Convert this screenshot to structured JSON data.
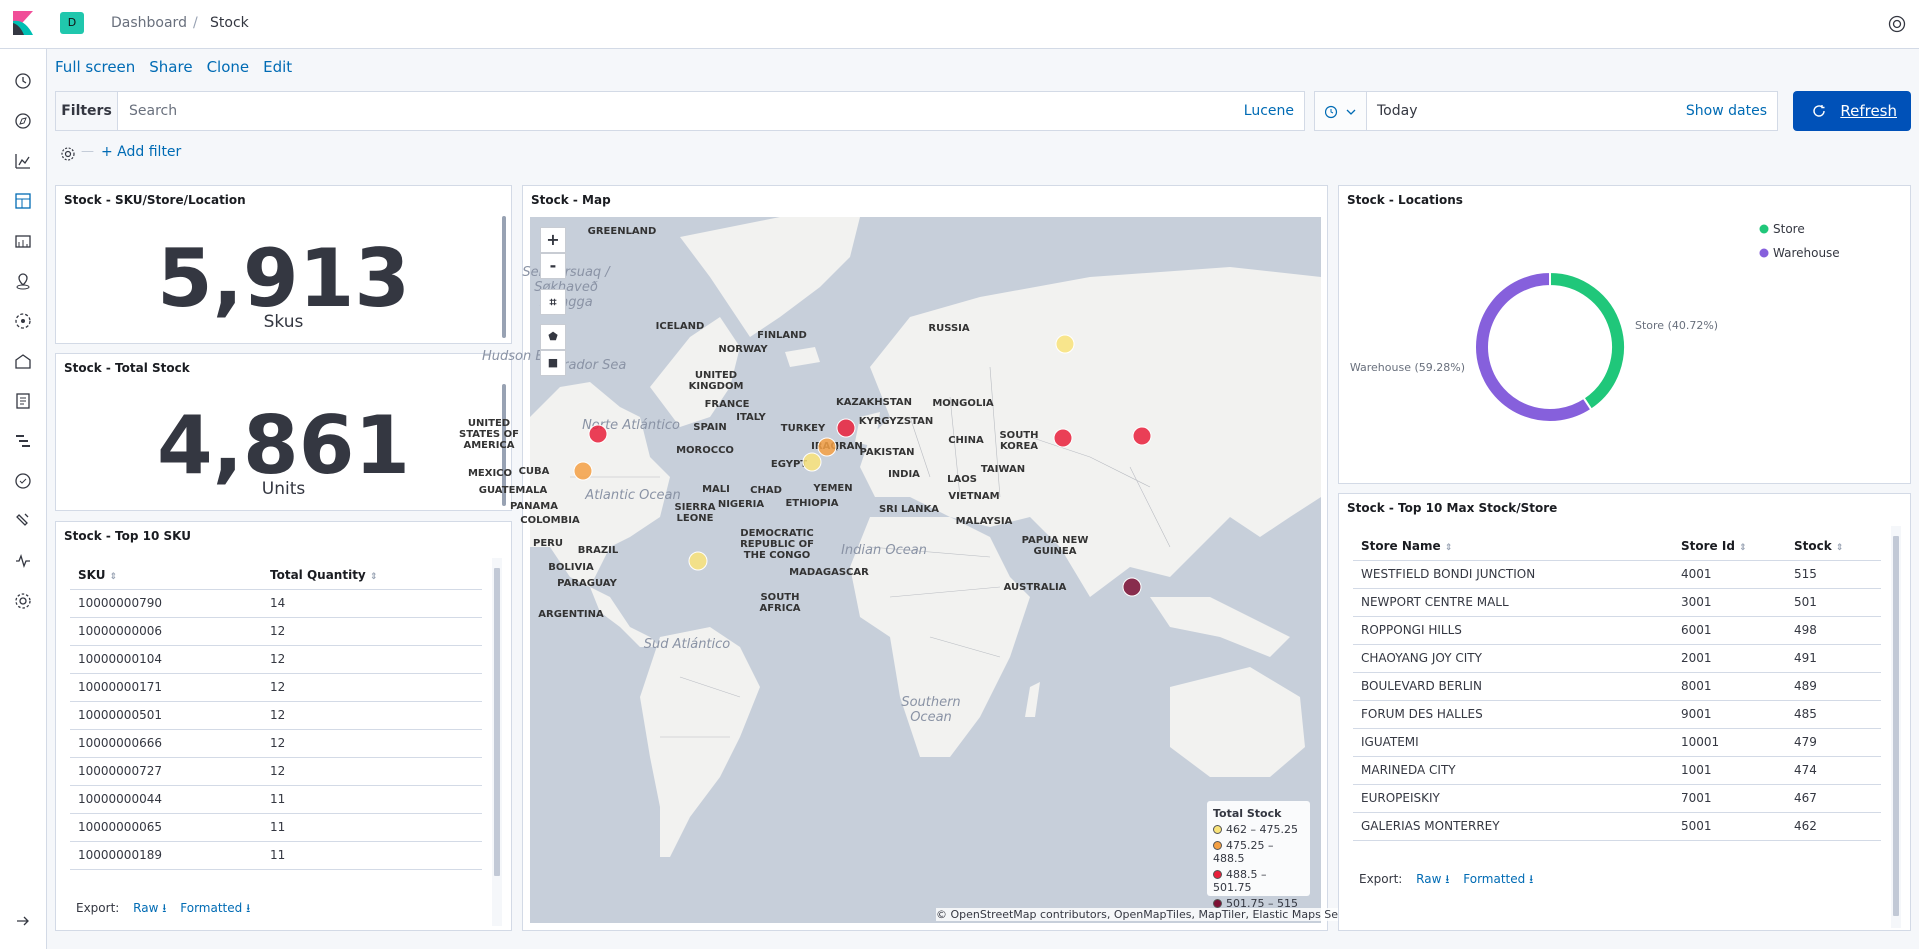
{
  "breadcrumb": {
    "parent": "Dashboard",
    "current": "Stock"
  },
  "space_initial": "D",
  "menu": {
    "full_screen": "Full screen",
    "share": "Share",
    "clone": "Clone",
    "edit": "Edit"
  },
  "query": {
    "filters_label": "Filters",
    "search_placeholder": "Search",
    "language": "Lucene"
  },
  "date": {
    "value": "Today",
    "show_dates": "Show dates",
    "refresh": "Refresh"
  },
  "filter_bar": {
    "add_filter": "+ Add filter"
  },
  "panels": {
    "sku": {
      "title": "Stock - SKU/Store/Location",
      "value": "5,913",
      "unit": "Skus"
    },
    "total": {
      "title": "Stock - Total Stock",
      "value": "4,861",
      "unit": "Units"
    },
    "map": {
      "title": "Stock - Map"
    },
    "locations": {
      "title": "Stock - Locations"
    },
    "top_sku": {
      "title": "Stock - Top 10 SKU"
    },
    "top_store": {
      "title": "Stock - Top 10 Max Stock/Store"
    }
  },
  "top_sku_table": {
    "headers": [
      "SKU",
      "Total Quantity"
    ],
    "rows": [
      [
        "10000000790",
        "14"
      ],
      [
        "10000000006",
        "12"
      ],
      [
        "10000000104",
        "12"
      ],
      [
        "10000000171",
        "12"
      ],
      [
        "10000000501",
        "12"
      ],
      [
        "10000000666",
        "12"
      ],
      [
        "10000000727",
        "12"
      ],
      [
        "10000000044",
        "11"
      ],
      [
        "10000000065",
        "11"
      ],
      [
        "10000000189",
        "11"
      ]
    ]
  },
  "top_store_table": {
    "headers": [
      "Store Name",
      "Store Id",
      "Stock"
    ],
    "rows": [
      [
        "WESTFIELD BONDI JUNCTION",
        "4001",
        "515"
      ],
      [
        "NEWPORT CENTRE MALL",
        "3001",
        "501"
      ],
      [
        "ROPPONGI HILLS",
        "6001",
        "498"
      ],
      [
        "CHAOYANG JOY CITY",
        "2001",
        "491"
      ],
      [
        "BOULEVARD BERLIN",
        "8001",
        "489"
      ],
      [
        "FORUM DES HALLES",
        "9001",
        "485"
      ],
      [
        "IGUATEMI",
        "10001",
        "479"
      ],
      [
        "MARINEDA CITY",
        "1001",
        "474"
      ],
      [
        "EUROPEISKIY",
        "7001",
        "467"
      ],
      [
        "GALERIAS MONTERREY",
        "5001",
        "462"
      ]
    ]
  },
  "export": {
    "label": "Export:",
    "raw": "Raw",
    "formatted": "Formatted"
  },
  "chart_data": {
    "type": "pie",
    "donut": true,
    "categories": [
      "Store",
      "Warehouse"
    ],
    "values": [
      40.72,
      59.28
    ],
    "labels": [
      "Store (40.72%)",
      "Warehouse (59.28%)"
    ],
    "colors": [
      "#20c77a",
      "#8660dc"
    ],
    "legend": "top-right"
  },
  "map_legend": {
    "title": "Total Stock",
    "items": [
      {
        "label": "462 – 475.25",
        "color": "#f9e37a"
      },
      {
        "label": "475.25 – 488.5",
        "color": "#f4a044"
      },
      {
        "label": "488.5 – 501.75",
        "color": "#e9203b"
      },
      {
        "label": "501.75 – 515",
        "color": "#7d1034"
      }
    ]
  },
  "map_labels": [
    "GREENLAND",
    "ICELAND",
    "FINLAND",
    "NORWAY",
    "RUSSIA",
    "UNITED KINGDOM",
    "FRANCE",
    "SPAIN",
    "ITALY",
    "KAZAKHSTAN",
    "MONGOLIA",
    "KYRGYZSTAN",
    "TURKEY",
    "IRAQ",
    "IRAN",
    "PAKISTAN",
    "CHINA",
    "SOUTH KOREA",
    "MOROCCO",
    "EGYPT",
    "INDIA",
    "LAOS",
    "VIETNAM",
    "TAIWAN",
    "UNITED STATES OF AMERICA",
    "MEXICO",
    "CUBA",
    "GUATEMALA",
    "PANAMA",
    "COLOMBIA",
    "MALI",
    "CHAD",
    "YEMEN",
    "SIERRA LEONE",
    "NIGERIA",
    "ETHIOPIA",
    "SRI LANKA",
    "MALAYSIA",
    "PAPUA NEW GUINEA",
    "DEMOCRATIC REPUBLIC OF THE CONGO",
    "PERU",
    "BRAZIL",
    "BOLIVIA",
    "PARAGUAY",
    "ARGENTINA",
    "MADAGASCAR",
    "SOUTH AFRICA",
    "AUSTRALIA"
  ],
  "map_oceans": [
    "Atlantic Ocean",
    "Indian Ocean",
    "Southern Ocean",
    "Norte Atlántico",
    "Sud Atlántico",
    "Labrador Sea",
    "Hudson Bay",
    "Sermersuaq / Søkhaveð mangga"
  ],
  "map_attribution": "© OpenStreetMap contributors, OpenMapTiles, MapTiler, Elastic Maps Service",
  "map_controls": {
    "zoom_in": "+",
    "zoom_out": "-"
  }
}
